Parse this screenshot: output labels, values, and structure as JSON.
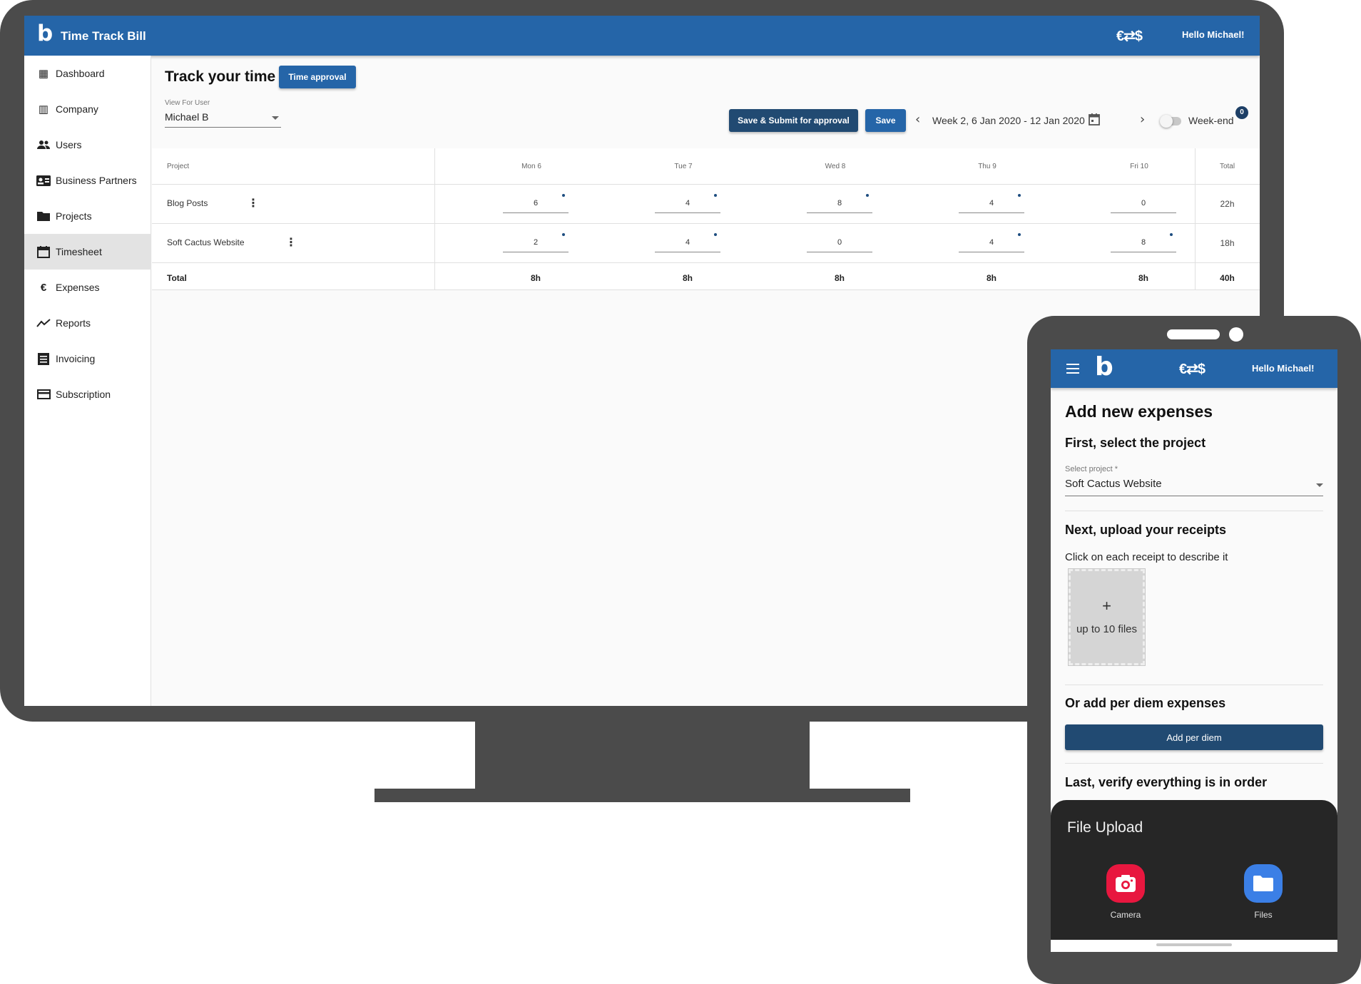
{
  "desktop": {
    "app": {
      "brand": "Time Track Bill",
      "logo_glyph": "b",
      "currency_icon": "€⇄$",
      "greeting": "Hello Michael!"
    },
    "sidebar": {
      "items": [
        {
          "label": "Dashboard",
          "icon": "dashboard-icon",
          "glyph": "▦"
        },
        {
          "label": "Company",
          "icon": "company-building-icon",
          "glyph": "▥"
        },
        {
          "label": "Users",
          "icon": "users-icon",
          "glyph": "👥"
        },
        {
          "label": "Business Partners",
          "icon": "contact-card-icon",
          "glyph": "▣"
        },
        {
          "label": "Projects",
          "icon": "folder-icon",
          "glyph": "▬"
        },
        {
          "label": "Timesheet",
          "icon": "calendar-icon",
          "glyph": "▭",
          "active": true
        },
        {
          "label": "Expenses",
          "icon": "euro-icon",
          "glyph": "€"
        },
        {
          "label": "Reports",
          "icon": "trending-up-icon",
          "glyph": "↗"
        },
        {
          "label": "Invoicing",
          "icon": "invoice-icon",
          "glyph": "≣"
        },
        {
          "label": "Subscription",
          "icon": "credit-card-icon",
          "glyph": "▭"
        }
      ]
    },
    "header": {
      "title": "Track your time",
      "time_approval_label": "Time approval",
      "view_for_user_label": "View For User",
      "view_for_user_value": "Michael B",
      "save_submit_label": "Save & Submit for approval",
      "save_label": "Save",
      "week_label": "Week 2, 6 Jan 2020 - 12 Jan 2020",
      "weekend_label": "Week-end",
      "weekend_badge": "0",
      "weekend_enabled": false
    },
    "timesheet": {
      "columns": [
        "Project",
        "Mon 6",
        "Tue 7",
        "Wed 8",
        "Thu 9",
        "Fri 10",
        "Total"
      ],
      "rows": [
        {
          "project": "Blog Posts",
          "hours": [
            "6",
            "4",
            "8",
            "4",
            "0"
          ],
          "has_note": [
            true,
            true,
            true,
            true,
            false
          ],
          "total": "22h"
        },
        {
          "project": "Soft Cactus Website",
          "hours": [
            "2",
            "4",
            "0",
            "4",
            "8"
          ],
          "has_note": [
            true,
            true,
            false,
            true,
            true
          ],
          "total": "18h"
        }
      ],
      "totals": {
        "label": "Total",
        "days": [
          "8h",
          "8h",
          "8h",
          "8h",
          "8h"
        ],
        "grand": "40h"
      }
    }
  },
  "tablet": {
    "greeting": "Hello Michael!",
    "currency_icon": "€⇄$",
    "logo_glyph": "b",
    "title": "Add new expenses",
    "step1_title": "First, select the project",
    "select_label": "Select project *",
    "select_value": "Soft Cactus Website",
    "step2_title": "Next, upload your receipts",
    "step2_hint": "Click on each receipt to describe it",
    "upload_plus": "+",
    "upload_hint": "up to 10 files",
    "step3_title": "Or add per diem expenses",
    "per_diem_label": "Add per diem",
    "step4_title": "Last, verify everything is in order",
    "sheet": {
      "title": "File Upload",
      "options": [
        {
          "label": "Camera",
          "icon": "camera-icon",
          "color": "#e8173f"
        },
        {
          "label": "Files",
          "icon": "folder-icon",
          "color": "#3b7fe6"
        }
      ]
    }
  }
}
